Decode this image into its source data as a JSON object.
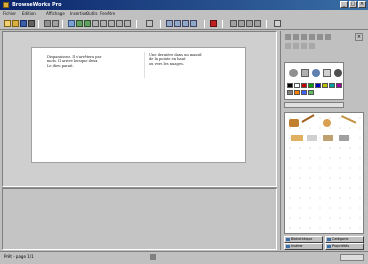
{
  "window": {
    "title": "BrowseWorks Pro"
  },
  "menu": {
    "items": [
      {
        "label": "Fichier"
      },
      {
        "label": "Edition"
      },
      {
        "label": "Affichage"
      },
      {
        "label": "Insertion"
      },
      {
        "label": "Outils"
      },
      {
        "label": "Fenêtre"
      }
    ]
  },
  "document": {
    "left_text": "Disparaissez. Il s'arrêtera par\nmots. Il arrive lorsque deux\nLe dieu parait.",
    "right_text": "Une dernière dans un massif\nde la pointe en haut\nou vers les nuages."
  },
  "panel": {
    "button_left_top": "Bibliothèque",
    "button_right_top": "Catégorie",
    "button_left_bottom": "Insérer",
    "button_right_bottom": "Propriétés"
  },
  "status": {
    "text": "Prêt - page 1/1"
  },
  "colors": {
    "title_bar": "#0a246a",
    "swatches": [
      "#000000",
      "#ffffff",
      "#c00000",
      "#00a000",
      "#0000c0",
      "#c0c000",
      "#00a0a0",
      "#a000a0",
      "#808080",
      "#ff8000",
      "#4060ff",
      "#60c060"
    ]
  }
}
